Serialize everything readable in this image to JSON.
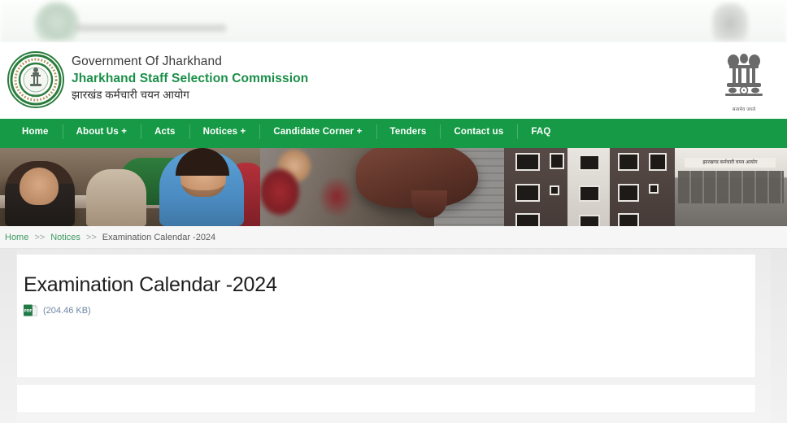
{
  "site": {
    "gov_line": "Government Of Jharkhand",
    "org_name_en": "Jharkhand Staff Selection Commission",
    "org_name_hi": "झारखंड कर्मचारी चयन आयोग",
    "emblem_motto": "सत्यमेव जयते",
    "brand_green": "#1a8f48",
    "nav_green": "#169a46"
  },
  "nav": {
    "items": [
      {
        "label": "Home"
      },
      {
        "label": "About Us +"
      },
      {
        "label": "Acts"
      },
      {
        "label": "Notices +"
      },
      {
        "label": "Candidate Corner +"
      },
      {
        "label": "Tenders"
      },
      {
        "label": "Contact us"
      },
      {
        "label": "FAQ"
      }
    ]
  },
  "banner": {
    "building_sign": "झारखण्ड कर्मचारी चयन आयोग"
  },
  "breadcrumb": {
    "home": "Home",
    "sep1": ">>",
    "section": "Notices",
    "sep2": ">>",
    "current": "Examination Calendar -2024"
  },
  "page": {
    "title": "Examination Calendar -2024",
    "attachment": {
      "icon": "pdf-file-icon",
      "size_label": "(204.46 KB)",
      "link_color": "#6d87a3"
    }
  }
}
